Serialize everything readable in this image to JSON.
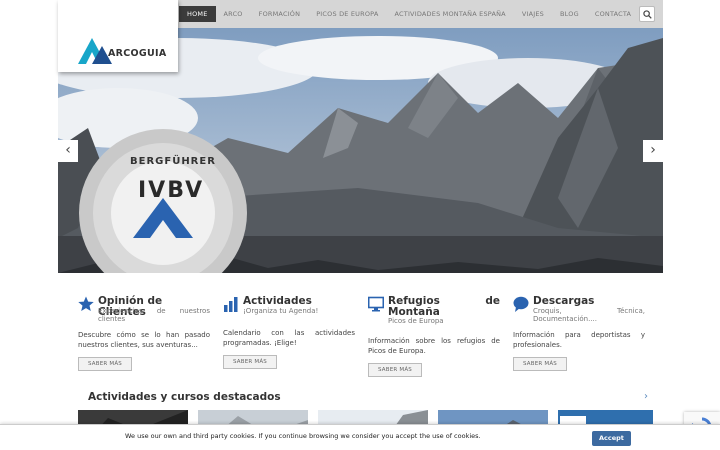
{
  "nav": {
    "items": [
      {
        "label": "HOME",
        "active": true
      },
      {
        "label": "ARCO"
      },
      {
        "label": "FORMACIÓN"
      },
      {
        "label": "PICOS DE EUROPA"
      },
      {
        "label": "ACTIVIDADES MONTAÑA ESPAÑA"
      },
      {
        "label": "VIAJES"
      },
      {
        "label": "BLOG"
      },
      {
        "label": "CONTACTA"
      }
    ],
    "search_icon": "search-icon"
  },
  "logo": {
    "text": "ARCOGUIA",
    "icon": "mountain-logo"
  },
  "hero": {
    "prev_arrow": "‹",
    "next_arrow": "›",
    "badge_top": "BERGFÜHRER",
    "badge_center": "IVBV"
  },
  "features": [
    {
      "icon": "star-icon",
      "title": "Opinión de Clientes",
      "subtitle": "Experiencias de nuestros clientes",
      "desc": "Descubre cómo se lo han pasado nuestros clientes, sus aventuras...",
      "button": "SABER MÁS"
    },
    {
      "icon": "bar-chart-icon",
      "title": "Actividades",
      "subtitle": "¡Organiza tu Agenda!",
      "desc": "Calendario con las actividades programadas. ¡Elige!",
      "button": "SABER MÁS"
    },
    {
      "icon": "monitor-icon",
      "title": "Refugios de Montaña",
      "subtitle": "Picos de Europa",
      "desc": "Información sobre los refugios de Picos de Europa.",
      "button": "SABER MÁS"
    },
    {
      "icon": "chat-bubble-icon",
      "title": "Descargas",
      "subtitle": "Croquis, Técnica, Documentación....",
      "desc": "Información para deportistas y profesionales.",
      "button": "SABER MÁS"
    }
  ],
  "featured": {
    "title": "Actividades y cursos destacados",
    "next_arrow": "›"
  },
  "cookie": {
    "text": "We use our own and third party cookies. If you continue browsing we consider you accept the use of cookies.",
    "button": "Accept"
  },
  "colors": {
    "accent_blue": "#2a63b0",
    "logo_cyan": "#18a6c9",
    "nav_bg": "#d6d6d6",
    "nav_active": "#3b3b3b",
    "cookie_button": "#3c6aa0"
  }
}
